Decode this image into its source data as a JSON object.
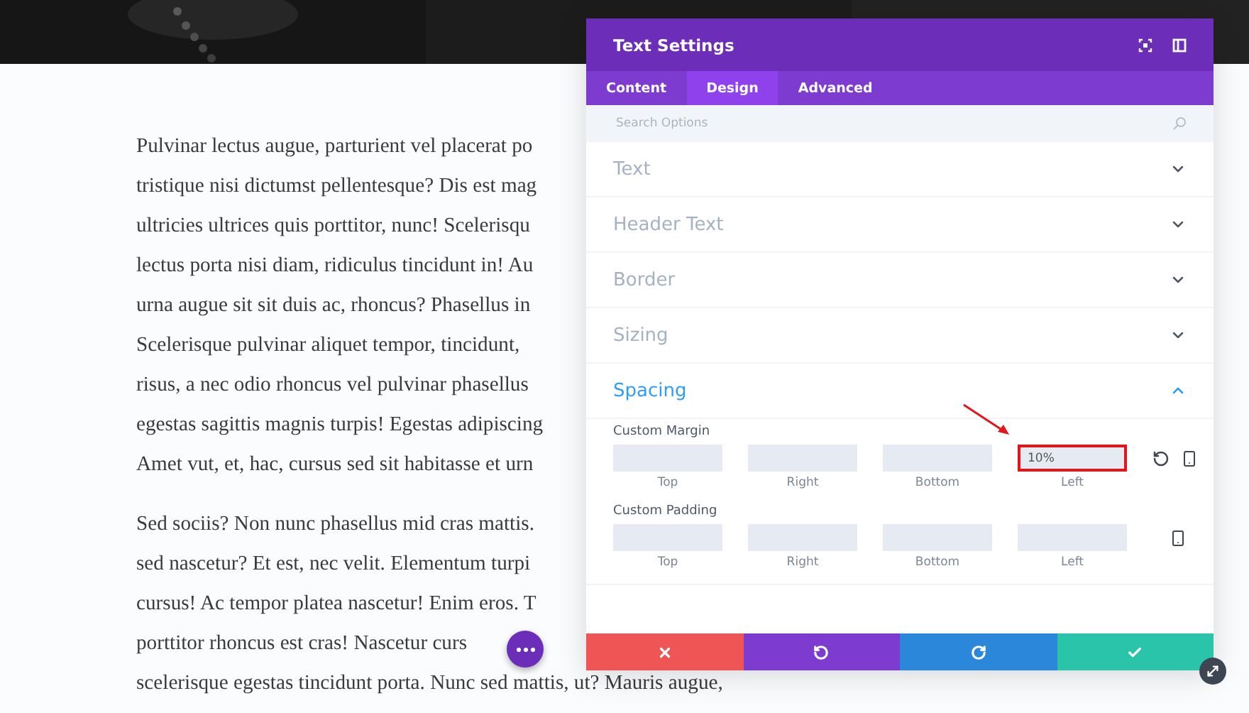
{
  "article": {
    "paragraphs": [
      [
        "Pulvinar lectus augue, parturient vel placerat po",
        "tristique nisi dictumst pellentesque? Dis est mag",
        "ultricies ultrices quis porttitor, nunc! Scelerisqu",
        "lectus porta nisi diam, ridiculus tincidunt in! Au",
        "urna augue sit sit duis ac, rhoncus? Phasellus in",
        "Scelerisque pulvinar aliquet tempor, tincidunt,",
        "risus, a nec odio rhoncus vel pulvinar phasellus",
        "egestas sagittis magnis turpis! Egestas adipiscing",
        "Amet vut, et, hac, cursus sed sit habitasse et urn"
      ],
      [
        "Sed sociis? Non nunc phasellus mid cras mattis.",
        "sed nascetur? Et est, nec velit. Elementum turpi",
        "cursus! Ac tempor platea nascetur! Enim eros. T",
        "porttitor rhoncus est cras! Nascetur curs",
        "scelerisque egestas tincidunt porta. Nunc sed mattis, ut? Mauris augue,"
      ]
    ]
  },
  "panel": {
    "title": "Text Settings",
    "tabs": [
      {
        "label": "Content",
        "selected": false
      },
      {
        "label": "Design",
        "selected": true
      },
      {
        "label": "Advanced",
        "selected": false
      }
    ],
    "search": {
      "placeholder": "Search Options"
    },
    "sections": [
      {
        "title": "Text",
        "expanded": false
      },
      {
        "title": "Header Text",
        "expanded": false
      },
      {
        "title": "Border",
        "expanded": false
      },
      {
        "title": "Sizing",
        "expanded": false
      },
      {
        "title": "Spacing",
        "expanded": true,
        "groups": [
          {
            "label": "Custom Margin",
            "reset": true,
            "fields": [
              {
                "label": "Top",
                "highlighted": false
              },
              {
                "label": "Right",
                "highlighted": false
              },
              {
                "label": "Bottom",
                "highlighted": false
              },
              {
                "label": "Left",
                "value": "10%",
                "highlighted": true
              }
            ]
          },
          {
            "label": "Custom Padding",
            "reset": false,
            "fields": [
              {
                "label": "Top",
                "highlighted": false
              },
              {
                "label": "Right",
                "highlighted": false
              },
              {
                "label": "Bottom",
                "highlighted": false
              },
              {
                "label": "Left",
                "highlighted": false
              }
            ]
          }
        ]
      }
    ],
    "footer": [
      {
        "kind": "cancel"
      },
      {
        "kind": "undo"
      },
      {
        "kind": "redo"
      },
      {
        "kind": "save"
      }
    ]
  }
}
